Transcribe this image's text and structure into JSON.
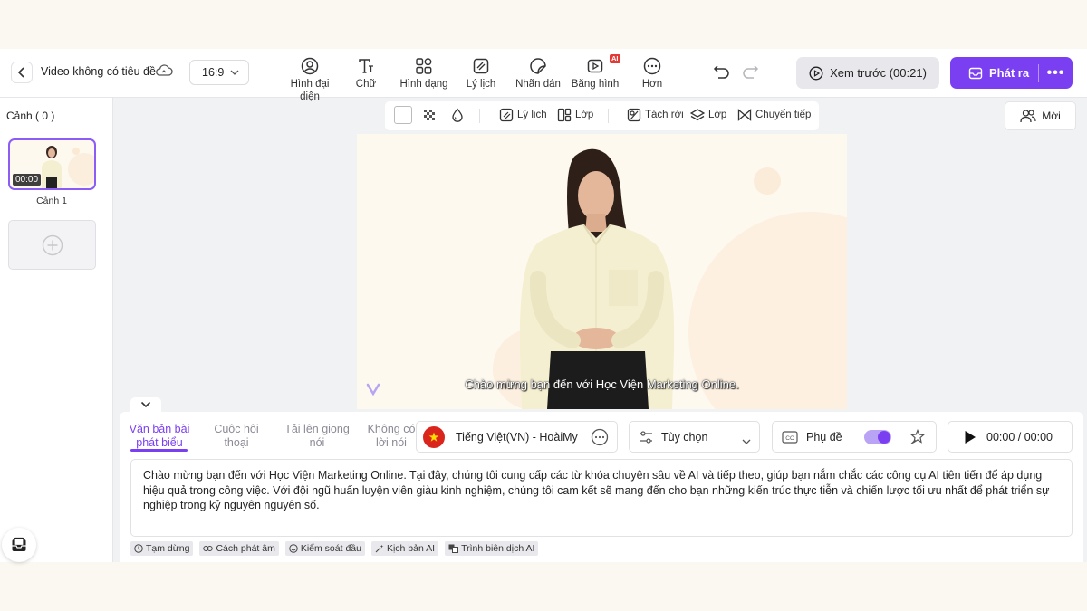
{
  "header": {
    "title": "Video không có tiêu đề",
    "ratio": "16:9",
    "tools": [
      {
        "label_line1": "Hình đại",
        "label_line2": "diện",
        "icon": "avatar-icon"
      },
      {
        "label_line1": "Chữ",
        "label_line2": "",
        "icon": "text-icon"
      },
      {
        "label_line1": "Hình dạng",
        "label_line2": "",
        "icon": "shapes-icon"
      },
      {
        "label_line1": "Lý lịch",
        "label_line2": "",
        "icon": "background-icon"
      },
      {
        "label_line1": "Nhãn dán",
        "label_line2": "",
        "icon": "sticker-icon"
      },
      {
        "label_line1": "Băng hình",
        "label_line2": "",
        "icon": "video-icon"
      },
      {
        "label_line1": "Hơn",
        "label_line2": "",
        "icon": "more-icon"
      }
    ],
    "ai_badge": "AI",
    "preview_label": "Xem trước (00:21)",
    "publish_label": "Phát ra"
  },
  "left_panel": {
    "scenes_title": "Cảnh ( 0 )",
    "scene_time": "00:00",
    "scene_label": "Cảnh 1"
  },
  "canvas_toolbar": {
    "background_label": "Lý lịch",
    "layer_label": "Lớp",
    "detach_label": "Tách rời",
    "layer2_label": "Lớp",
    "transition_label": "Chuyển tiếp"
  },
  "invite_label": "Mời",
  "canvas": {
    "subtitle": "Chào mừng bạn đến với Học Viện Marketing Online."
  },
  "script_panel": {
    "tabs": [
      {
        "line1": "Văn bản bài",
        "line2": "phát biểu"
      },
      {
        "line1": "Cuộc hội",
        "line2": "thoại"
      },
      {
        "line1": "Tải lên giọng",
        "line2": "nói"
      },
      {
        "line1": "Không có",
        "line2": "lời nói"
      }
    ],
    "voice": "Tiếng Việt(VN) - HoàiMy",
    "options_label": "Tùy chọn",
    "subtitle_label": "Phụ đề",
    "time": "00:00 / 00:00",
    "script_text": "Chào mừng bạn đến với Học Viện Marketing Online. Tại đây, chúng tôi cung cấp các từ khóa chuyên sâu về AI và tiếp theo, giúp bạn nắm chắc các công cụ AI tiên tiến để áp dụng hiệu quả trong công việc. Với đội ngũ huấn luyện viên giàu kinh nghiệm, chúng tôi cam kết sẽ mang đến cho bạn những kiến trúc thực tiễn và chiến lược tối ưu nhất để phát triển sự nghiệp trong kỷ nguyên nguyên số.",
    "chips": [
      "Tạm dừng",
      "Cách phát âm",
      "Kiểm soát đầu",
      "Kịch bản AI",
      "Trình biên dịch AI"
    ]
  },
  "colors": {
    "accent": "#7b3ff2",
    "canvas_bg": "#fdf9ef",
    "shirt": "#f4efd0"
  }
}
